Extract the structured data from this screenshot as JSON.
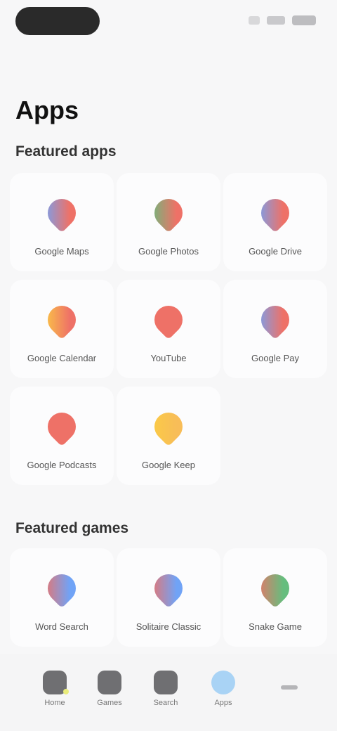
{
  "status": {
    "time_pill": "",
    "battery_icon": "battery-icon"
  },
  "page": {
    "title": "Apps"
  },
  "sections": [
    {
      "title": "Featured apps",
      "apps": [
        {
          "name": "Google Maps",
          "icon": "maps-icon",
          "colors": [
            "#4285f4",
            "#ea4335"
          ]
        },
        {
          "name": "Google Photos",
          "icon": "photos-icon",
          "colors": [
            "#34a853",
            "#ea4335"
          ]
        },
        {
          "name": "Google Drive",
          "icon": "drive-icon",
          "colors": [
            "#4285f4",
            "#ea4335"
          ]
        },
        {
          "name": "Google Calendar",
          "icon": "calendar-icon",
          "colors": [
            "#fbbc05",
            "#ea4335"
          ]
        },
        {
          "name": "YouTube",
          "icon": "youtube-icon",
          "colors": [
            "#ea4335",
            "#ea4335"
          ]
        },
        {
          "name": "Google Pay",
          "icon": "pay-icon",
          "colors": [
            "#4285f4",
            "#ea4335"
          ]
        },
        {
          "name": "Google Podcasts",
          "icon": "podcasts-icon",
          "colors": [
            "#ea4335",
            "#ea4335"
          ]
        },
        {
          "name": "Google Keep",
          "icon": "keep-icon",
          "colors": [
            "#fbbc05",
            "#f6a821"
          ]
        }
      ]
    },
    {
      "title": "Featured games",
      "apps": [
        {
          "name": "Word Search",
          "icon": "game-1-icon",
          "colors": [
            "#ea4335",
            "#4285f4"
          ]
        },
        {
          "name": "Solitaire Classic",
          "icon": "game-2-icon",
          "colors": [
            "#ea4335",
            "#4285f4"
          ]
        },
        {
          "name": "Snake Game",
          "icon": "game-3-icon",
          "colors": [
            "#ea4335",
            "#34a853"
          ]
        }
      ]
    }
  ],
  "nav": [
    {
      "label": "Home",
      "icon": "home-icon"
    },
    {
      "label": "Games",
      "icon": "games-icon"
    },
    {
      "label": "Search",
      "icon": "search-icon"
    },
    {
      "label": "Apps",
      "icon": "apps-icon",
      "active": true
    }
  ]
}
